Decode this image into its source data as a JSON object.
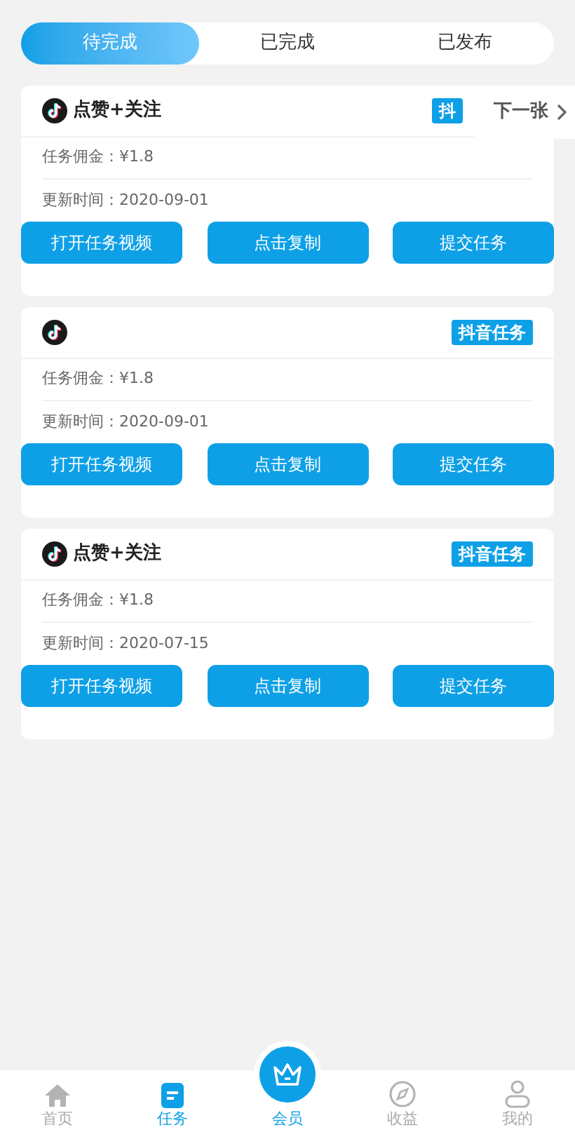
{
  "tabs": [
    {
      "label": "待完成",
      "selected": true
    },
    {
      "label": "已完成",
      "selected": false
    },
    {
      "label": "已发布",
      "selected": false
    }
  ],
  "tasks": [
    {
      "title": "点赞+关注",
      "badge": "抖",
      "commission": "任务佣金：¥1.8",
      "updated": "更新时间：2020-09-01",
      "buttons": [
        "打开任务视频",
        "点击复制",
        "提交任务"
      ],
      "next": "下一张"
    },
    {
      "badge": "抖音任务",
      "commission": "任务佣金：¥1.8",
      "updated": "更新时间：2020-09-01",
      "buttons": [
        "打开任务视频",
        "点击复制",
        "提交任务"
      ]
    },
    {
      "title": "点赞+关注",
      "badge": "抖音任务",
      "commission": "任务佣金：¥1.8",
      "updated": "更新时间：2020-07-15",
      "buttons": [
        "打开任务视频",
        "点击复制",
        "提交任务"
      ]
    }
  ],
  "nav": [
    {
      "kind": "home",
      "label": "首页",
      "selected": false
    },
    {
      "kind": "task",
      "label": "任务",
      "selected": true
    },
    {
      "kind": "center",
      "label": "会员",
      "selected": true
    },
    {
      "kind": "compass",
      "label": "收益",
      "selected": false
    },
    {
      "kind": "person",
      "label": "我的",
      "selected": false
    }
  ]
}
